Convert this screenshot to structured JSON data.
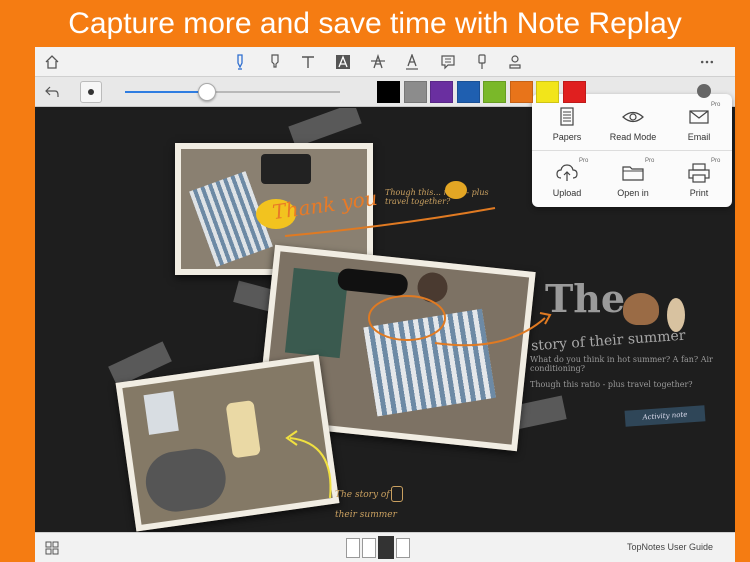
{
  "headline": "Capture more and save time with Note Replay",
  "toolbar": {
    "icons": [
      "home-icon",
      "pen-icon",
      "marker-icon",
      "text-icon",
      "highlight-text-icon",
      "strikethrough-icon",
      "underline-icon",
      "comment-icon",
      "pin-icon",
      "stamp-icon",
      "more-icon"
    ]
  },
  "toolbar2": {
    "stroke_level": 0.38,
    "colors": [
      "#000000",
      "#8c8c8c",
      "#6a2fa0",
      "#1f5fb0",
      "#7ab829",
      "#e8741a",
      "#f2e51a",
      "#e01f1f"
    ]
  },
  "popover": {
    "items": [
      {
        "label": "Papers",
        "pro": false,
        "icon": "papers-icon"
      },
      {
        "label": "Read Mode",
        "pro": false,
        "icon": "eye-icon"
      },
      {
        "label": "Email",
        "pro": true,
        "icon": "envelope-icon"
      },
      {
        "label": "Upload",
        "pro": true,
        "icon": "cloud-upload-icon"
      },
      {
        "label": "Open in",
        "pro": true,
        "icon": "folder-icon"
      },
      {
        "label": "Print",
        "pro": true,
        "icon": "printer-icon"
      }
    ],
    "pro_label": "Pro"
  },
  "canvas": {
    "note_thanks": "Thank you",
    "note_top": "Though this... retro - plus travel together?",
    "title_big": "The",
    "subtitle": "story of their summer",
    "line1": "What do you think in hot summer? A fan? Air conditioning?",
    "line2": "Though this ratio - plus travel together?",
    "tag": "Activity note",
    "bottom_note1": "The story of",
    "bottom_note2": "their summer"
  },
  "bottombar": {
    "guide_label": "TopNotes User Guide"
  }
}
